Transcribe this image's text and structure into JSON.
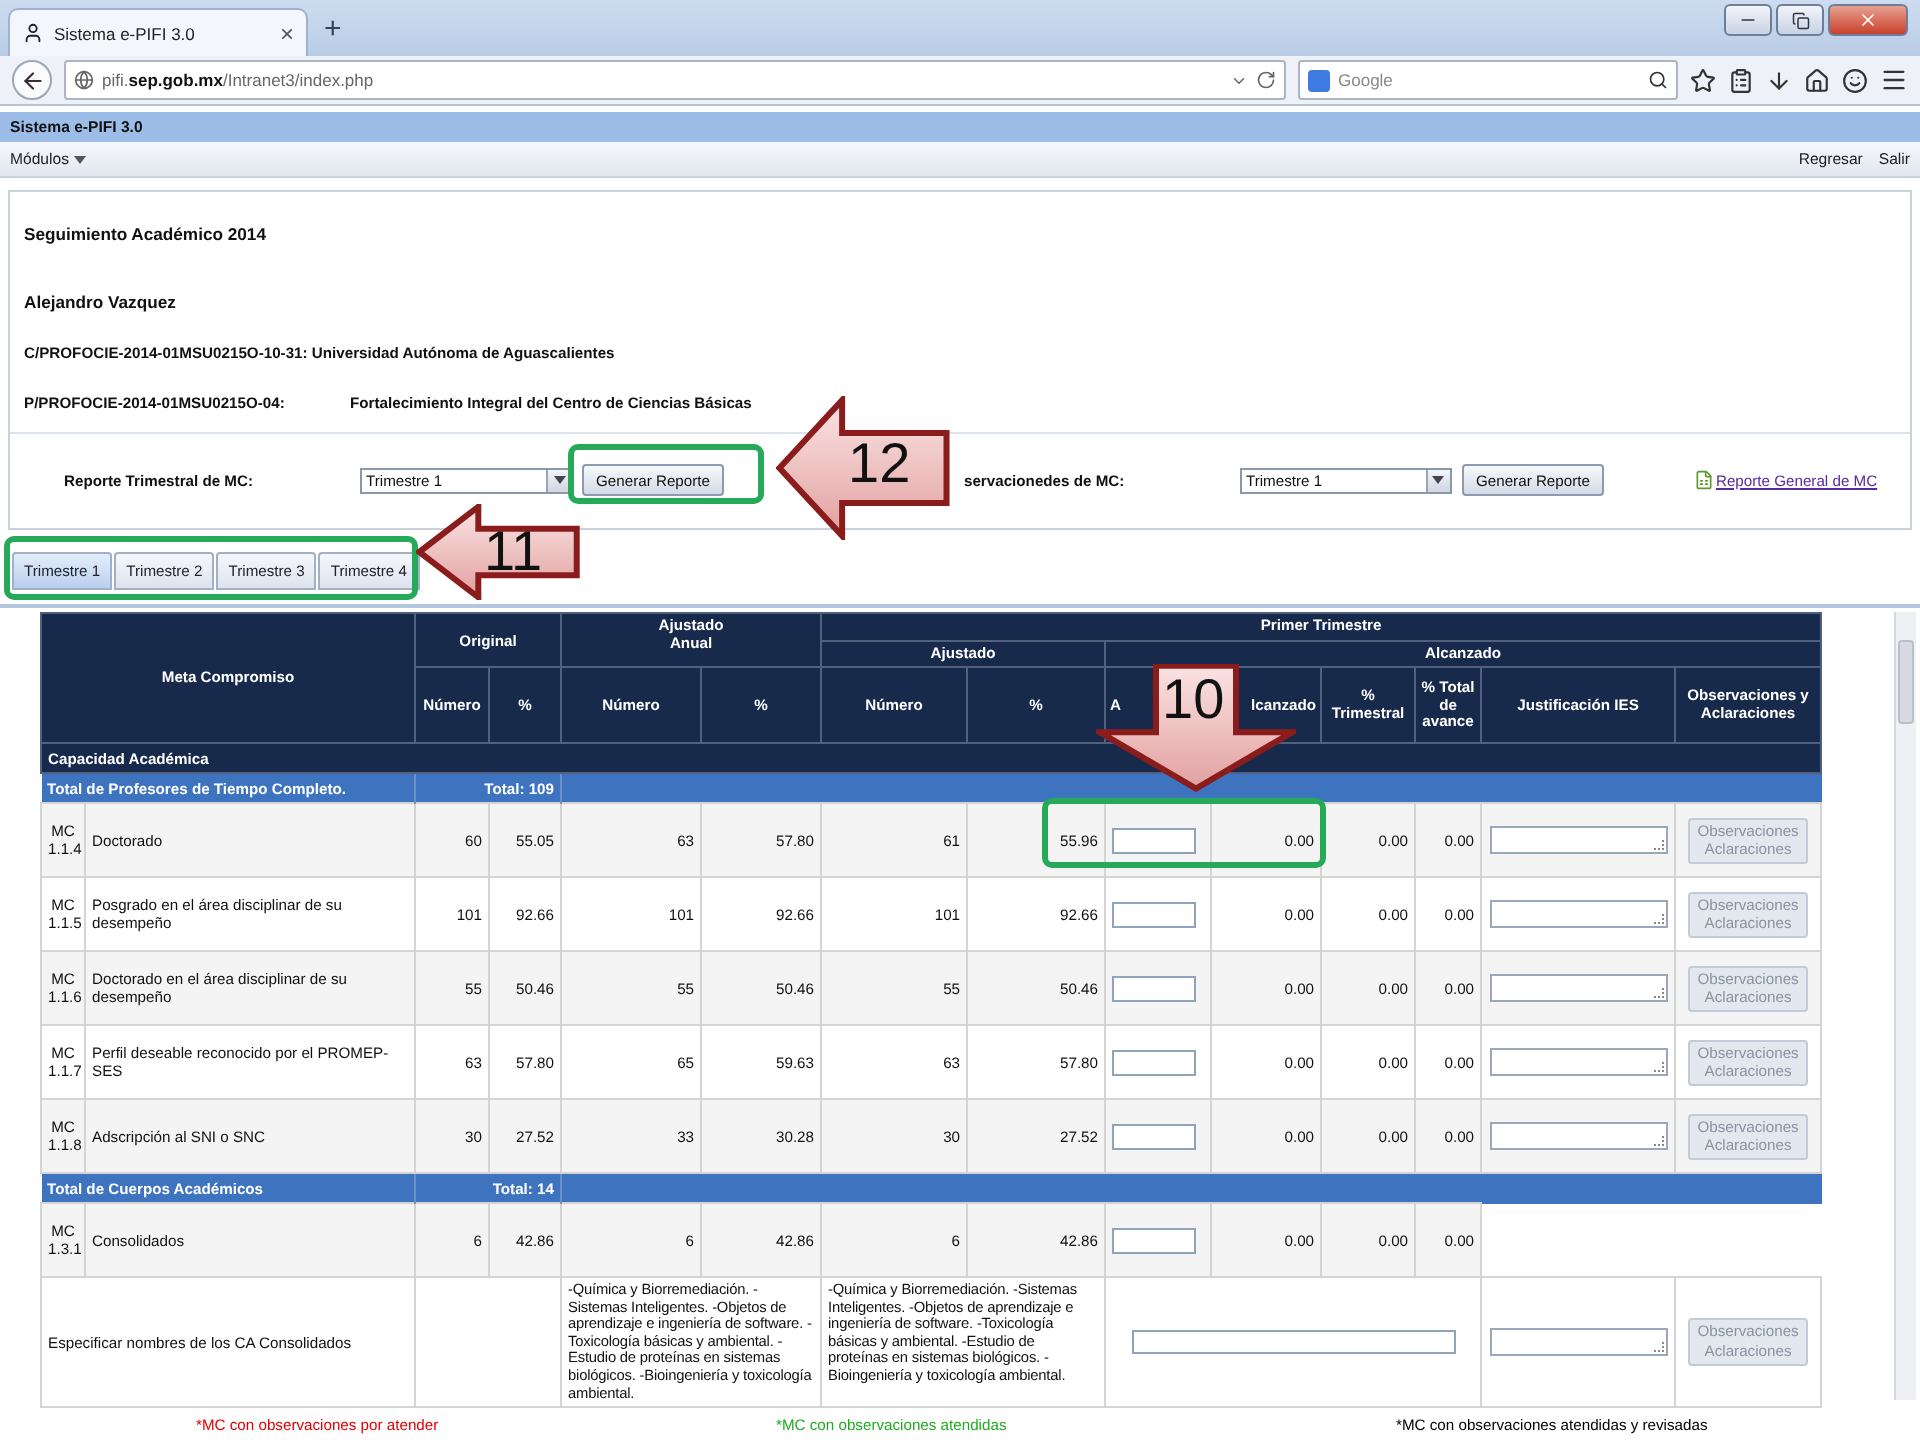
{
  "browser": {
    "tab_title": "Sistema e-PIFI 3.0",
    "close": "×",
    "new_tab": "+",
    "url": "pifi.**sep.gob.mx**/Intranet3/index.php",
    "search_placeholder": "Google"
  },
  "app": {
    "title": "Sistema e-PIFI 3.0",
    "menu": "Módulos",
    "nav_links": [
      "Regresar",
      "Salir"
    ]
  },
  "header": {
    "title": "Seguimiento Académico 2014",
    "user": "Alejandro Vazquez",
    "lines": [
      {
        "label": "C/PROFOCIE-2014-01MSU0215O-10-31: Universidad Autónoma de Aguascalientes"
      },
      {
        "label": "P/PROFOCIE-2014-01MSU0215O-04:",
        "value": "Fortalecimiento Integral del Centro de Ciencias Básicas"
      }
    ]
  },
  "reports": [
    {
      "label": "Reporte Trimestral de MC:",
      "select": "Trimestre 1",
      "button": "Generar Reporte"
    },
    {
      "label": "servacionedes de MC:",
      "select": "Trimestre 1",
      "button": "Generar Reporte"
    }
  ],
  "report_link": "Reporte General de MC",
  "tabs": [
    {
      "label": "Trimestre 1",
      "selected": true
    },
    {
      "label": "Trimestre 2",
      "selected": false
    },
    {
      "label": "Trimestre 3",
      "selected": false
    },
    {
      "label": "Trimestre 4",
      "selected": false
    }
  ],
  "table": {
    "head": {
      "meta": "Meta Compromiso",
      "original": "Original",
      "ajustado_anual": "Ajustado Anual",
      "period": "Primer Trimestre",
      "ajustado": "Ajustado",
      "alcanzado": "Alcanzado",
      "subheads": [
        "Número",
        "%",
        "Número",
        "%",
        "Número",
        "%",
        "A",
        "lcanzado",
        "% Trimestral",
        "% Total de avance",
        "Justificación IES",
        "Observaciones y Aclaraciones"
      ]
    },
    "rows": [
      {
        "kind": "section",
        "label": "Capacidad Académica"
      },
      {
        "kind": "group",
        "label": "Total de Profesores de Tiempo Completo.",
        "total": "Total: 109"
      },
      {
        "kind": "item",
        "code": "MC 1.1.4",
        "name": "Doctorado",
        "values": [
          "60",
          "55.05",
          "63",
          "57.80",
          "61",
          "55.96"
        ],
        "reached": [
          "0.00",
          "0.00",
          "0.00"
        ],
        "button": "Observaciones Aclaraciones",
        "disabled": true
      },
      {
        "kind": "item",
        "code": "MC 1.1.5",
        "name": "Posgrado en el área disciplinar de su desempeño",
        "values": [
          "101",
          "92.66",
          "101",
          "92.66",
          "101",
          "92.66"
        ],
        "reached": [
          "0.00",
          "0.00",
          "0.00"
        ],
        "button": "Observaciones Aclaraciones",
        "disabled": true
      },
      {
        "kind": "item",
        "code": "MC 1.1.6",
        "name": "Doctorado en el área disciplinar de su desempeño",
        "values": [
          "55",
          "50.46",
          "55",
          "50.46",
          "55",
          "50.46"
        ],
        "reached": [
          "0.00",
          "0.00",
          "0.00"
        ],
        "button": "Observaciones Aclaraciones",
        "disabled": true
      },
      {
        "kind": "item",
        "code": "MC 1.1.7",
        "name": "Perfil deseable reconocido por el PROMEP-SES",
        "values": [
          "63",
          "57.80",
          "65",
          "59.63",
          "63",
          "57.80"
        ],
        "reached": [
          "0.00",
          "0.00",
          "0.00"
        ],
        "button": "Observaciones Aclaraciones",
        "disabled": true
      },
      {
        "kind": "item",
        "code": "MC 1.1.8",
        "name": "Adscripción al SNI o SNC",
        "values": [
          "30",
          "27.52",
          "33",
          "30.28",
          "30",
          "27.52"
        ],
        "reached": [
          "0.00",
          "0.00",
          "0.00"
        ],
        "button": "Observaciones Aclaraciones",
        "disabled": true
      },
      {
        "kind": "group",
        "label": "Total de Cuerpos Académicos",
        "total": "Total: 14"
      },
      {
        "kind": "item",
        "code": "MC 1.3.1",
        "name": "Consolidados",
        "values": [
          "6",
          "42.86",
          "6",
          "42.86",
          "6",
          "42.86"
        ],
        "reached": [
          "0.00",
          "0.00",
          "0.00"
        ]
      },
      {
        "kind": "detail",
        "label": "Especificar nombres de los CA Consolidados",
        "ajustado_anual": "-Química y Biorremediación. -Sistemas Inteligentes. -Objetos de aprendizaje e ingeniería de software. -Toxicología básicas y ambiental. -Estudio de proteínas en sistemas biológicos. -Bioingeniería y toxicología ambiental.",
        "ajustado": "-Química y Biorremediación. -Sistemas Inteligentes. -Objetos de aprendizaje e ingeniería de software. -Toxicología básicas y ambiental. -Estudio de proteínas en sistemas biológicos. -Bioingeniería y toxicología ambiental.",
        "button": "Observaciones Aclaraciones",
        "disabled": true
      }
    ]
  },
  "legend": [
    {
      "label": "*MC con observaciones por atender",
      "color": "#e00000"
    },
    {
      "label": "*MC con observaciones atendidas",
      "color": "#22aa22"
    },
    {
      "label": "*MC con observaciones atendidas y revisadas",
      "color": "#000000"
    }
  ],
  "callouts": [
    {
      "number": "12"
    },
    {
      "number": "11"
    },
    {
      "number": "10"
    }
  ]
}
